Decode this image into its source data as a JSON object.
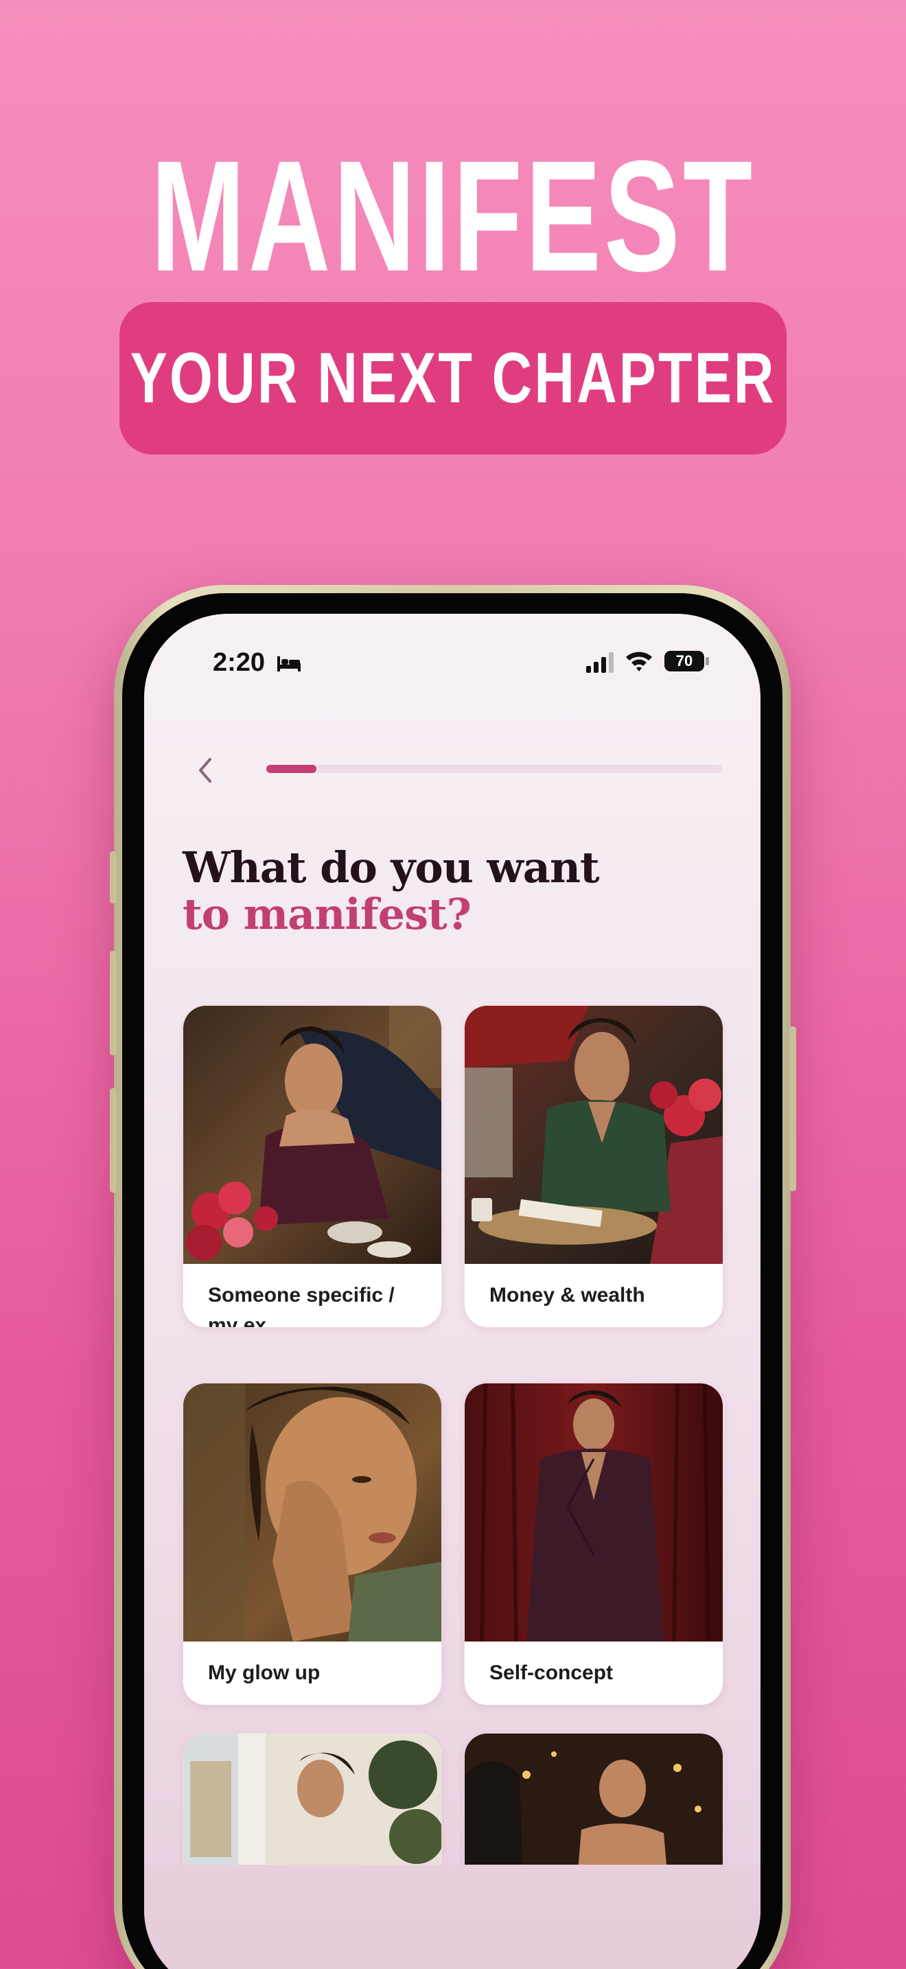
{
  "promo": {
    "headline": "MANIFEST",
    "subheadline": "YOUR NEXT CHAPTER"
  },
  "status_bar": {
    "time": "2:20",
    "mode_icon": "bed-icon",
    "signal_icon": "signal-icon",
    "wifi_icon": "wifi-icon",
    "battery_level": "70"
  },
  "navigation": {
    "back_icon": "chevron-left-icon",
    "progress_fraction": 0.11
  },
  "question": {
    "line1": "What do you want",
    "line2": "to manifest?"
  },
  "options": [
    {
      "label": "Someone specific / my ex",
      "image": "couple-lounge-photo"
    },
    {
      "label": "Money & wealth",
      "image": "cafe-journaling-photo"
    },
    {
      "label": "My glow up",
      "image": "glowing-skin-photo"
    },
    {
      "label": "Self-concept",
      "image": "suit-curtains-photo"
    },
    {
      "label": "",
      "image": "window-sunlight-photo"
    },
    {
      "label": "",
      "image": "candlelit-dinner-photo"
    }
  ],
  "colors": {
    "background_top": "#f68ebd",
    "background_bottom": "#df4c91",
    "pill": "#e03d80",
    "accent": "#c23f74",
    "title_dark": "#23121c"
  }
}
